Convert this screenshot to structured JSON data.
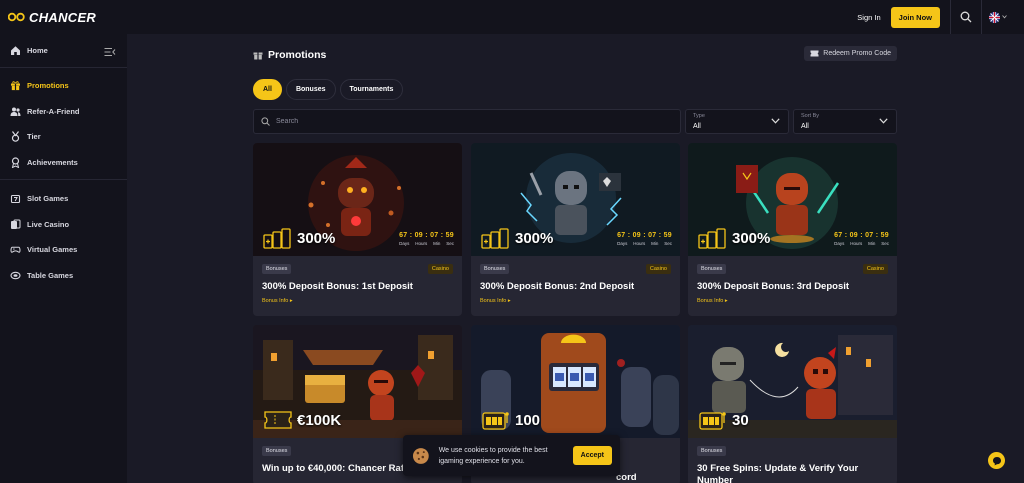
{
  "brand": {
    "name": "CHANCER"
  },
  "header": {
    "signin_label": "Sign In",
    "join_label": "Join Now"
  },
  "sidebar": {
    "items": [
      {
        "label": "Home",
        "icon": "home-icon"
      },
      {
        "label": "Promotions",
        "icon": "gift-icon",
        "active": true
      },
      {
        "label": "Refer-A-Friend",
        "icon": "users-icon"
      },
      {
        "label": "Tier",
        "icon": "medal-icon"
      },
      {
        "label": "Achievements",
        "icon": "award-icon"
      },
      {
        "label": "Slot Games",
        "icon": "slot-icon"
      },
      {
        "label": "Live Casino",
        "icon": "cards-icon"
      },
      {
        "label": "Virtual Games",
        "icon": "gamepad-icon"
      },
      {
        "label": "Table Games",
        "icon": "table-icon"
      }
    ]
  },
  "page": {
    "title": "Promotions",
    "redeem_label": "Redeem Promo Code",
    "tabs": [
      "All",
      "Bonuses",
      "Tournaments"
    ],
    "search_placeholder": "Search",
    "type_label": "Type",
    "type_value": "All",
    "sort_label": "Sort By",
    "sort_value": "All"
  },
  "timer": {
    "value": "67 : 09 : 07 : 59",
    "days": "Days",
    "hours": "Hours",
    "min": "Min",
    "sec": "Sec"
  },
  "cards": [
    {
      "bonus": "300%",
      "tag": "Bonuses",
      "tag2": "Casino",
      "title": "300% Deposit Bonus: 1st Deposit",
      "link": "Bonus Info"
    },
    {
      "bonus": "300%",
      "tag": "Bonuses",
      "tag2": "Casino",
      "title": "300% Deposit Bonus: 2nd Deposit",
      "link": "Bonus Info"
    },
    {
      "bonus": "300%",
      "tag": "Bonuses",
      "tag2": "Casino",
      "title": "300% Deposit Bonus: 3rd Deposit",
      "link": "Bonus Info"
    },
    {
      "bonus": "€100K",
      "tag": "Bonuses",
      "title": "Win up to €40,000: Chancer Raffle"
    },
    {
      "bonus": "100",
      "title": "cord"
    },
    {
      "bonus": "30",
      "tag": "Bonuses",
      "title": "30 Free Spins: Update & Verify Your Number"
    }
  ],
  "cookie": {
    "text": "We use cookies to provide the best igaming experience for you.",
    "accept_label": "Accept"
  },
  "colors": {
    "accent": "#f5c518",
    "bg": "#1a1a26",
    "panel": "#13131c",
    "card": "#262633"
  }
}
